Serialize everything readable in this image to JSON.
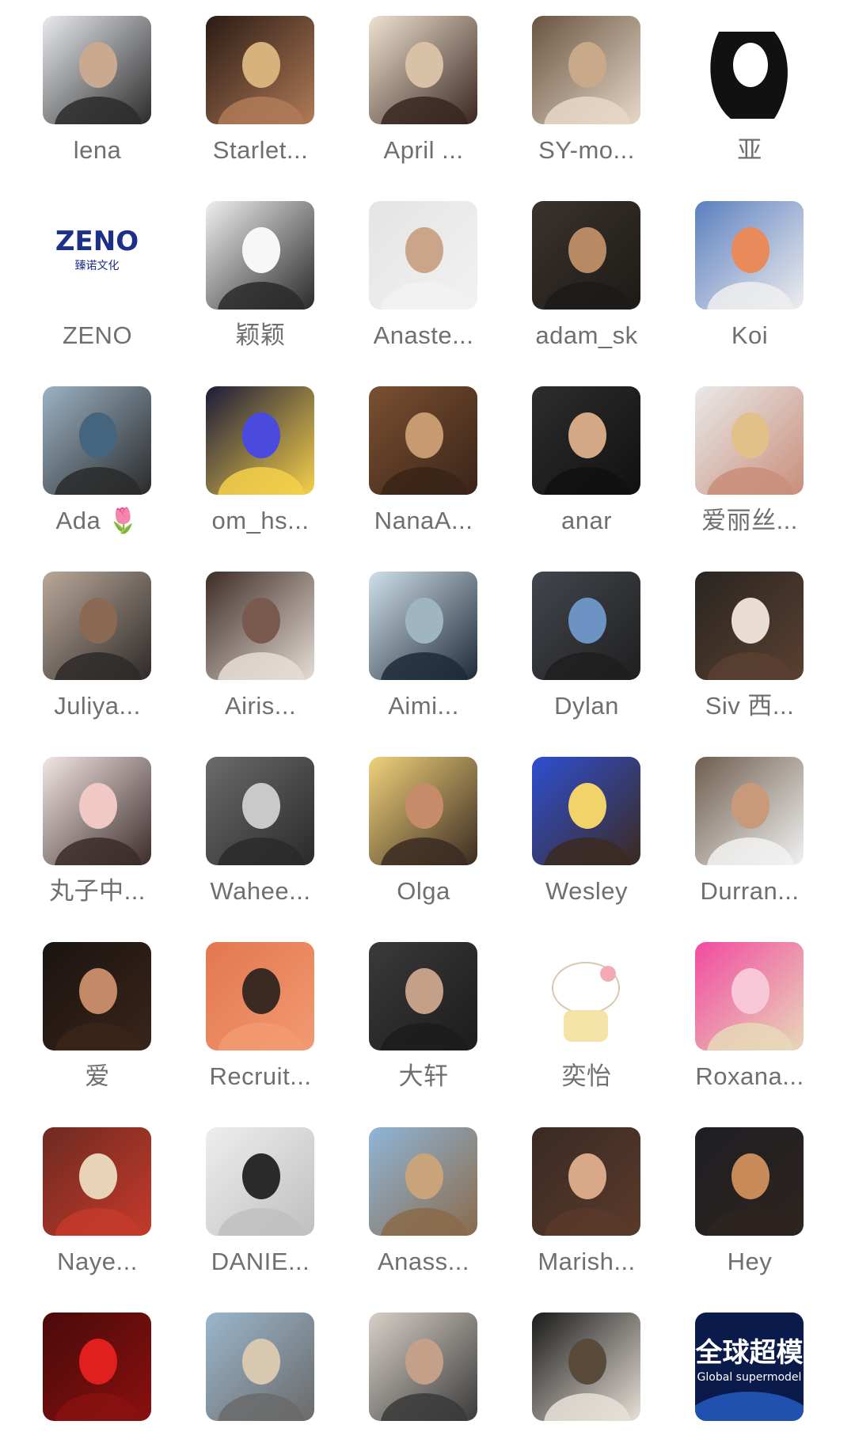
{
  "contacts": [
    {
      "name": "lena",
      "palette": [
        "#e8eaee",
        "#c9a98f",
        "#2b2b2b"
      ],
      "kind": "photo"
    },
    {
      "name": "Starlet...",
      "palette": [
        "#2a1b14",
        "#d8b27c",
        "#b07a57"
      ],
      "kind": "photo"
    },
    {
      "name": "April ...",
      "palette": [
        "#efe2d0",
        "#d9c1a8",
        "#3a2620"
      ],
      "kind": "photo"
    },
    {
      "name": "SY-mo...",
      "palette": [
        "#6a5440",
        "#c8a98a",
        "#e6d8c8"
      ],
      "kind": "photo"
    },
    {
      "name": "亚",
      "palette": [
        "#ffffff",
        "#111111",
        "#555555"
      ],
      "kind": "sketch"
    },
    {
      "name": "ZENO",
      "palette": [
        "#ffffff",
        "#1c2f8a",
        "#1c2f8a"
      ],
      "kind": "logo",
      "logo_text": "ZENO",
      "logo_sub": "臻诺文化"
    },
    {
      "name": "颖颖",
      "palette": [
        "#efefef",
        "#f7f7f7",
        "#2a2a2a"
      ],
      "kind": "photo"
    },
    {
      "name": "Anaste...",
      "palette": [
        "#e4e4e4",
        "#caa58a",
        "#f2f2f2"
      ],
      "kind": "photo"
    },
    {
      "name": "adam_sk",
      "palette": [
        "#3a332c",
        "#b88a64",
        "#1d1a17"
      ],
      "kind": "photo"
    },
    {
      "name": "Koi",
      "palette": [
        "#5b7fbf",
        "#e88a5a",
        "#eeeeee"
      ],
      "kind": "photo"
    },
    {
      "name": "Ada",
      "emoji": "🌷",
      "palette": [
        "#9bb2c4",
        "#45657e",
        "#2a2a2a"
      ],
      "kind": "photo"
    },
    {
      "name": "om_hs...",
      "palette": [
        "#1b1b3a",
        "#4a4adf",
        "#f5d04a"
      ],
      "kind": "photo"
    },
    {
      "name": "NanaA...",
      "palette": [
        "#7a5032",
        "#c79a72",
        "#3a2418"
      ],
      "kind": "photo"
    },
    {
      "name": "anar",
      "palette": [
        "#2d2d2d",
        "#d4a884",
        "#111111"
      ],
      "kind": "photo"
    },
    {
      "name": "爱丽丝...",
      "palette": [
        "#e9e9e9",
        "#e2c08a",
        "#c98e7a"
      ],
      "kind": "photo"
    },
    {
      "name": "Juliya...",
      "palette": [
        "#b9a899",
        "#8a6a55",
        "#2e2a29"
      ],
      "kind": "photo"
    },
    {
      "name": "Airis...",
      "palette": [
        "#3e2c26",
        "#7a5a4e",
        "#e5ddd5"
      ],
      "kind": "photo"
    },
    {
      "name": "Aimi...",
      "palette": [
        "#cfe0ea",
        "#9fb6c2",
        "#1f2a38"
      ],
      "kind": "photo"
    },
    {
      "name": "Dylan",
      "palette": [
        "#42464d",
        "#6d93c4",
        "#1f1f1f"
      ],
      "kind": "photo"
    },
    {
      "name": "Siv 西...",
      "palette": [
        "#2a2521",
        "#e8ddd0",
        "#5a4030"
      ],
      "kind": "photo"
    },
    {
      "name": "丸子中...",
      "palette": [
        "#f2e6e4",
        "#f0c8c4",
        "#3b2c2a"
      ],
      "kind": "photo"
    },
    {
      "name": "Wahee...",
      "palette": [
        "#6b6b6b",
        "#c9c9c9",
        "#2a2a2a"
      ],
      "kind": "photo"
    },
    {
      "name": "Olga",
      "palette": [
        "#f0d27a",
        "#c68c6a",
        "#3b2b22"
      ],
      "kind": "photo"
    },
    {
      "name": "Wesley",
      "palette": [
        "#2f4fd1",
        "#f2d36a",
        "#3b2a20"
      ],
      "kind": "photo"
    },
    {
      "name": "Durran...",
      "palette": [
        "#6e5e4e",
        "#c89a7a",
        "#f2f2f2"
      ],
      "kind": "photo"
    },
    {
      "name": "爱",
      "palette": [
        "#1a1412",
        "#c48a68",
        "#3a2418"
      ],
      "kind": "photo"
    },
    {
      "name": "Recruit...",
      "palette": [
        "#e2774f",
        "#3a2a22",
        "#f29a72"
      ],
      "kind": "photo"
    },
    {
      "name": "大轩",
      "palette": [
        "#3a3a3a",
        "#c4a088",
        "#1c1c1c"
      ],
      "kind": "photo"
    },
    {
      "name": "奕怡",
      "palette": [
        "#ffffff",
        "#f5e2a6",
        "#f3a9b6"
      ],
      "kind": "cartoon"
    },
    {
      "name": "Roxana...",
      "palette": [
        "#f24aa0",
        "#f8c8d8",
        "#e8d8b8"
      ],
      "kind": "photo"
    },
    {
      "name": "Naye...",
      "palette": [
        "#6e2a22",
        "#e8d2b8",
        "#c43a2a"
      ],
      "kind": "photo"
    },
    {
      "name": "DANIE...",
      "palette": [
        "#eeeeee",
        "#2a2a2a",
        "#bfbfbf"
      ],
      "kind": "photo"
    },
    {
      "name": "Anass...",
      "palette": [
        "#8fb6d8",
        "#c9a47a",
        "#8a6a4a"
      ],
      "kind": "photo"
    },
    {
      "name": "Marish...",
      "palette": [
        "#3a2a24",
        "#d8a888",
        "#5a3a2a"
      ],
      "kind": "photo"
    },
    {
      "name": "Hey",
      "palette": [
        "#1e1e22",
        "#c98a5a",
        "#2e2420"
      ],
      "kind": "photo"
    },
    {
      "name": "",
      "palette": [
        "#4a0a0a",
        "#e0201e",
        "#8a1010"
      ],
      "kind": "photo"
    },
    {
      "name": "",
      "palette": [
        "#9ab6cc",
        "#d8c8b0",
        "#6a6a6a"
      ],
      "kind": "photo"
    },
    {
      "name": "",
      "palette": [
        "#d8d0c8",
        "#c4a088",
        "#3a3a3a"
      ],
      "kind": "photo"
    },
    {
      "name": "",
      "palette": [
        "#1a1a1a",
        "#5a4a3a",
        "#e8e0d8"
      ],
      "kind": "photo"
    },
    {
      "name": "",
      "palette": [
        "#0a1a4a",
        "#2a6ad8",
        "#ffffff"
      ],
      "kind": "logo",
      "logo_text": "全球超模",
      "logo_sub": "Global supermodel"
    }
  ]
}
